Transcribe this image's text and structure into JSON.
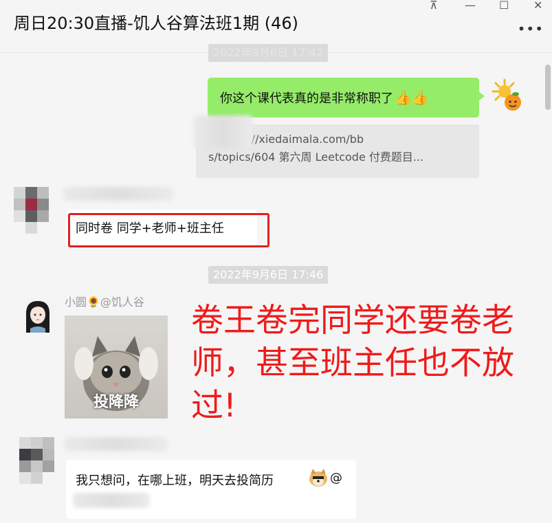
{
  "window": {
    "title": "周日20:30直播-饥人谷算法班1期 (46)",
    "controls": {
      "pin": "⊼",
      "minimize": "—",
      "maximize": "☐",
      "close": "✕"
    },
    "more_label": "•••"
  },
  "messages": {
    "timestamp_1": "2022年9月6日 17:42",
    "sent_text": "你这个课代表真的是非常称职了",
    "sent_emojis": "👍👍",
    "quote_line1": "：https://xiedaimala.com/bb",
    "quote_line2": "s/topics/604  第六周 Leetcode 付费题目...",
    "reply_text": "同时卷 同学+老师+班主任",
    "timestamp_2": "2022年9月6日 17:46",
    "sender_name": "小圆🌻@饥人谷",
    "meme_caption": "投降降",
    "last_text": "我只想问，在哪上班，明天去投简历",
    "last_suffix": "@"
  },
  "annotation": {
    "text": "卷王卷完同学还要卷老师，甚至班主任也不放过!",
    "color": "#f01a1a"
  },
  "colors": {
    "sent_bubble": "#95ec69",
    "highlight_box": "#e02020",
    "background": "#f5f5f5"
  }
}
